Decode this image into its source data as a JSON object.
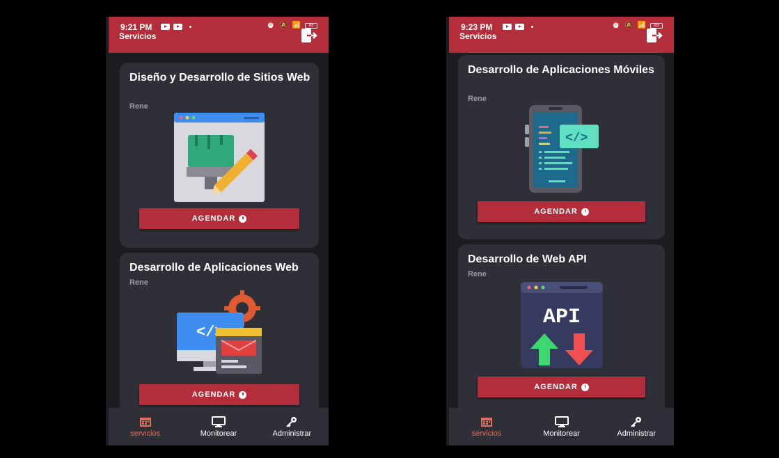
{
  "phones": [
    {
      "status_time": "9:21 PM",
      "battery": "93",
      "header_title": "Servicios",
      "cards": [
        {
          "title": "Diseño y Desarrollo de Sitios Web",
          "author": "Rene",
          "button": "AGENDAR"
        },
        {
          "title": "Desarrollo de Aplicaciones Web",
          "author": "Rene",
          "button": "AGENDAR"
        }
      ],
      "nav": [
        {
          "label": "servicios",
          "icon": "calendar-icon"
        },
        {
          "label": "Monitorear",
          "icon": "monitor-icon"
        },
        {
          "label": "Administrar",
          "icon": "key-icon"
        }
      ]
    },
    {
      "status_time": "9:23 PM",
      "battery": "93",
      "header_title": "Servicios",
      "cards": [
        {
          "title": "Desarrollo de Aplicaciones Móviles",
          "author": "Rene",
          "button": "AGENDAR"
        },
        {
          "title": "Desarrollo de Web API",
          "author": "Rene",
          "button": "AGENDAR",
          "image_text": "API"
        }
      ],
      "nav": [
        {
          "label": "servicios",
          "icon": "calendar-icon"
        },
        {
          "label": "Monitorear",
          "icon": "monitor-icon"
        },
        {
          "label": "Administrar",
          "icon": "key-icon"
        }
      ]
    }
  ],
  "colors": {
    "accent": "#b32d3a",
    "nav_active": "#e3705e",
    "card_bg": "#2e2f37",
    "page_bg": "#1c1d21"
  }
}
